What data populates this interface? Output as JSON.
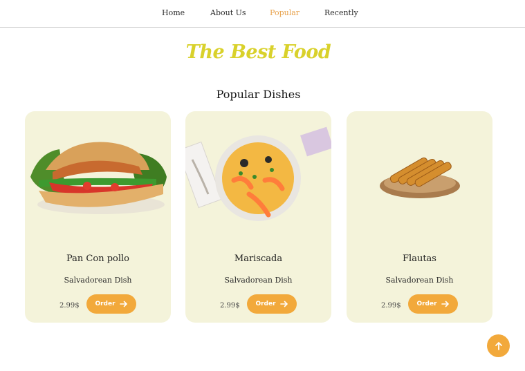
{
  "nav": {
    "items": [
      {
        "label": "Home"
      },
      {
        "label": "About Us"
      },
      {
        "label": "Popular"
      },
      {
        "label": "Recently"
      }
    ],
    "active": "Popular"
  },
  "brand": "The Best Food",
  "section_title": "Popular Dishes",
  "dishes": [
    {
      "name": "Pan Con pollo",
      "subtitle": "Salvadorean Dish",
      "price": "2.99$",
      "order_label": "Order",
      "image": "sandwich-image"
    },
    {
      "name": "Mariscada",
      "subtitle": "Salvadorean Dish",
      "price": "2.99$",
      "order_label": "Order",
      "image": "seafood-soup-image"
    },
    {
      "name": "Flautas",
      "subtitle": "Salvadorean Dish",
      "price": "2.99$",
      "order_label": "Order",
      "image": "flautas-image"
    }
  ],
  "colors": {
    "accent": "#f2a93b",
    "brand": "#d9d12b",
    "card_bg": "#f4f3da",
    "active_nav": "#e8a14a"
  },
  "icons": {
    "order": "arrow-right-icon",
    "scroll_top": "arrow-up-icon"
  }
}
